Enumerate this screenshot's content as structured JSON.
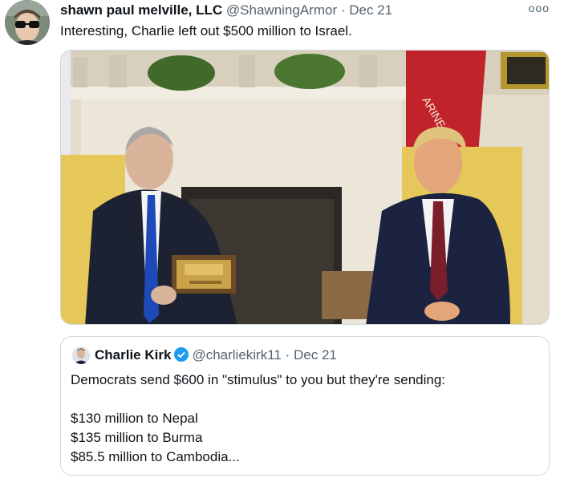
{
  "tweet": {
    "author_name": "shawn paul melville, LLC",
    "author_handle": "@ShawningArmor",
    "separator": "·",
    "date": "Dec 21",
    "more_label": "ooo",
    "text": "Interesting, Charlie left out $500 million to Israel."
  },
  "media": {
    "flag_text": "ARINE"
  },
  "quoted_tweet": {
    "author_name": "Charlie Kirk",
    "author_handle": "@charliekirk11",
    "separator": "·",
    "date": "Dec 21",
    "lines": [
      "Democrats send $600 in \"stimulus\" to you but they're sending:",
      "$130 million to Nepal",
      "$135 million to Burma",
      "$85.5 million to Cambodia..."
    ]
  },
  "colors": {
    "text": "#0f1419",
    "secondary_text": "#536471",
    "border": "#cfd9de",
    "verified": "#1d9bf0"
  }
}
